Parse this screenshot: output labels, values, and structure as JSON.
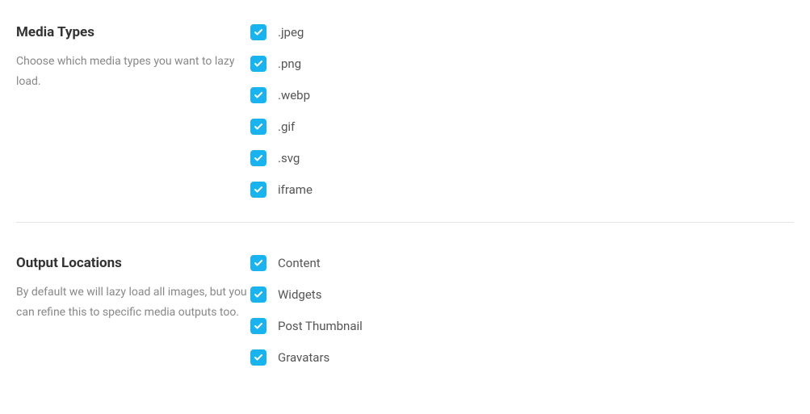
{
  "sections": {
    "media_types": {
      "title": "Media Types",
      "description": "Choose which media types you want to lazy load.",
      "items": [
        {
          "label": ".jpeg",
          "checked": true
        },
        {
          "label": ".png",
          "checked": true
        },
        {
          "label": ".webp",
          "checked": true
        },
        {
          "label": ".gif",
          "checked": true
        },
        {
          "label": ".svg",
          "checked": true
        },
        {
          "label": "iframe",
          "checked": true
        }
      ]
    },
    "output_locations": {
      "title": "Output Locations",
      "description": "By default we will lazy load all images, but you can refine this to specific media outputs too.",
      "items": [
        {
          "label": "Content",
          "checked": true
        },
        {
          "label": "Widgets",
          "checked": true
        },
        {
          "label": "Post Thumbnail",
          "checked": true
        },
        {
          "label": "Gravatars",
          "checked": true
        }
      ]
    }
  }
}
